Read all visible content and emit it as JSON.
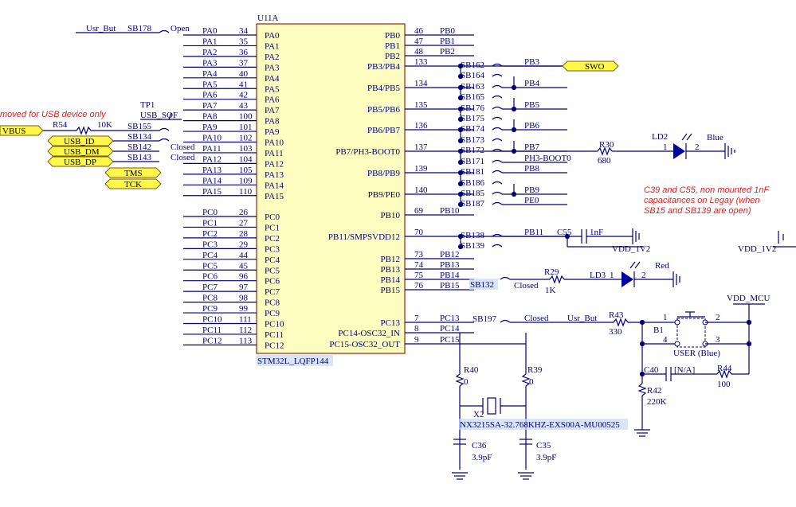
{
  "ic": {
    "designator": "U11A",
    "part": "STM32L_LQFP144",
    "left_pins": [
      {
        "num": "34",
        "name": "PA0",
        "net": "PA0"
      },
      {
        "num": "35",
        "name": "PA1",
        "net": "PA1"
      },
      {
        "num": "36",
        "name": "PA2",
        "net": "PA2"
      },
      {
        "num": "37",
        "name": "PA3",
        "net": "PA3"
      },
      {
        "num": "40",
        "name": "PA4",
        "net": "PA4"
      },
      {
        "num": "41",
        "name": "PA5",
        "net": "PA5"
      },
      {
        "num": "42",
        "name": "PA6",
        "net": "PA6"
      },
      {
        "num": "43",
        "name": "PA7",
        "net": "PA7"
      },
      {
        "num": "100",
        "name": "PA8",
        "net": "PA8"
      },
      {
        "num": "101",
        "name": "PA9",
        "net": "PA9"
      },
      {
        "num": "102",
        "name": "PA10",
        "net": "PA10"
      },
      {
        "num": "103",
        "name": "PA11",
        "net": "PA11"
      },
      {
        "num": "104",
        "name": "PA12",
        "net": "PA12"
      },
      {
        "num": "105",
        "name": "PA13",
        "net": "PA13"
      },
      {
        "num": "109",
        "name": "PA14",
        "net": "PA14"
      },
      {
        "num": "110",
        "name": "PA15",
        "net": "PA15"
      },
      {
        "num": "26",
        "name": "PC0",
        "net": "PC0"
      },
      {
        "num": "27",
        "name": "PC1",
        "net": "PC1"
      },
      {
        "num": "28",
        "name": "PC2",
        "net": "PC2"
      },
      {
        "num": "29",
        "name": "PC3",
        "net": "PC3"
      },
      {
        "num": "44",
        "name": "PC4",
        "net": "PC4"
      },
      {
        "num": "45",
        "name": "PC5",
        "net": "PC5"
      },
      {
        "num": "96",
        "name": "PC6",
        "net": "PC6"
      },
      {
        "num": "97",
        "name": "PC7",
        "net": "PC7"
      },
      {
        "num": "98",
        "name": "PC8",
        "net": "PC8"
      },
      {
        "num": "99",
        "name": "PC9",
        "net": "PC9"
      },
      {
        "num": "111",
        "name": "PC10",
        "net": "PC10"
      },
      {
        "num": "112",
        "name": "PC11",
        "net": "PC11"
      },
      {
        "num": "113",
        "name": "PC12",
        "net": "PC12"
      }
    ],
    "right_pins": [
      {
        "num": "46",
        "name": "PB0",
        "net": "PB0"
      },
      {
        "num": "47",
        "name": "PB1",
        "net": "PB1"
      },
      {
        "num": "48",
        "name": "PB2",
        "net": "PB2"
      },
      {
        "num": "133",
        "name": "PB3/PB4",
        "net": ""
      },
      {
        "num": "134",
        "name": "PB4/PB5",
        "net": ""
      },
      {
        "num": "135",
        "name": "PB5/PB6",
        "net": ""
      },
      {
        "num": "136",
        "name": "PB6/PB7",
        "net": ""
      },
      {
        "num": "137",
        "name": "PB7/PH3-BOOT0",
        "net": ""
      },
      {
        "num": "139",
        "name": "PB8/PB9",
        "net": ""
      },
      {
        "num": "140",
        "name": "PB9/PE0",
        "net": ""
      },
      {
        "num": "69",
        "name": "PB10",
        "net": "PB10"
      },
      {
        "num": "70",
        "name": "PB11/SMPSVDD12",
        "net": ""
      },
      {
        "num": "73",
        "name": "PB12",
        "net": "PB12"
      },
      {
        "num": "74",
        "name": "PB13",
        "net": "PB13"
      },
      {
        "num": "75",
        "name": "PB14",
        "net": "PB14"
      },
      {
        "num": "76",
        "name": "PB15",
        "net": "PB15"
      },
      {
        "num": "7",
        "name": "PC13",
        "net": "PC13"
      },
      {
        "num": "8",
        "name": "PC14-OSC32_IN",
        "net": "PC14"
      },
      {
        "num": "9",
        "name": "PC15-OSC32_OUT",
        "net": "PC15"
      }
    ]
  },
  "left_misc": {
    "usr_but_net": "Usr_But",
    "sb178": "SB178",
    "sb178_state": "Open",
    "note": "moved for USB device only",
    "vbus": "VBUS",
    "r54": "R54",
    "r54_val": "10K",
    "tp1": "TP1",
    "usb_sof": "USB_SOF",
    "sb155": "SB155",
    "sb134": "SB134",
    "sb142": "SB142",
    "sb143": "SB143",
    "closed": "Closed",
    "usb_id": "USB_ID",
    "usb_dm": "USB_DM",
    "usb_dp": "USB_DP",
    "tms": "TMS",
    "tck": "TCK"
  },
  "sb_labels": [
    "SB162",
    "SB164",
    "SB163",
    "SB165",
    "SB176",
    "SB175",
    "SB174",
    "SB173",
    "SB172",
    "SB171",
    "SB181",
    "SB186",
    "SB185",
    "SB187",
    "SB138",
    "SB139"
  ],
  "pb_nets": [
    "PB3",
    "PB4",
    "PB5",
    "PB6",
    "PB7",
    "PH3-BOOT0",
    "PB8",
    "PB9",
    "PE0",
    "PB11"
  ],
  "swo": "SWO",
  "ld2": {
    "ref": "LD2",
    "color": "Blue",
    "pin1": "1",
    "pin2": "2",
    "r": "R30",
    "rval": "680"
  },
  "note_red": [
    "C39 and C55, non mounted 1nF",
    "capacitances on Legay (when",
    "SB15 and SB139 are open)"
  ],
  "c55": {
    "ref": "C55",
    "val": "1nF"
  },
  "vdd_1v2": "VDD_1V2",
  "ld3": {
    "ref": "LD3",
    "color": "Red",
    "pin1": "1",
    "pin2": "2",
    "r": "R29",
    "rval": "1K",
    "sb": "SB132",
    "state": "Closed"
  },
  "vdd_mcu": "VDD_MCU",
  "pc13_side": {
    "sb": "SB197",
    "state": "Closed",
    "net": "Usr_But",
    "r": "R43",
    "rval": "330"
  },
  "b1": {
    "ref": "B1",
    "label": "USER (Blue)",
    "p1": "1",
    "p2": "2",
    "p3": "3",
    "p4": "4"
  },
  "c40": {
    "ref": "C40",
    "val": "[N/A]"
  },
  "r44": {
    "ref": "R44",
    "val": "100"
  },
  "r42": {
    "ref": "R42",
    "val": "220K"
  },
  "r40": {
    "ref": "R40",
    "val": "0"
  },
  "r39": {
    "ref": "R39",
    "val": "0"
  },
  "x2": {
    "ref": "X2",
    "part": "NX3215SA-32.768KHZ-EXS00A-MU00525"
  },
  "c36": {
    "ref": "C36",
    "val": "3.9pF"
  },
  "c35": {
    "ref": "C35",
    "val": "3.9pF"
  }
}
